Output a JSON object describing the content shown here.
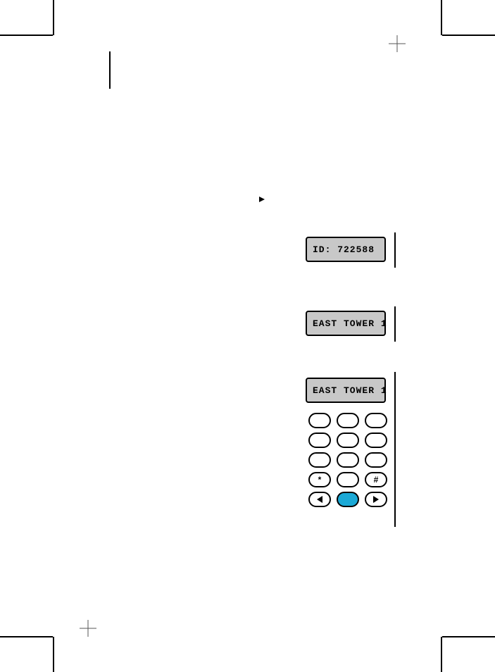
{
  "lcd": {
    "screen1": "ID: 722588",
    "screen2": "EAST TOWER 1",
    "screen3": "EAST TOWER 1"
  },
  "keypad": {
    "rows": [
      [
        "",
        "",
        ""
      ],
      [
        "",
        "",
        ""
      ],
      [
        "",
        "",
        ""
      ]
    ],
    "bottom_row": {
      "star": "*",
      "zero": "",
      "hash": "#"
    },
    "nav_row": {
      "left": "left-arrow",
      "center": "",
      "right": "right-arrow"
    }
  },
  "colors": {
    "lcd_bg": "#c8c8c8",
    "key_blue": "#1ba9d6"
  }
}
